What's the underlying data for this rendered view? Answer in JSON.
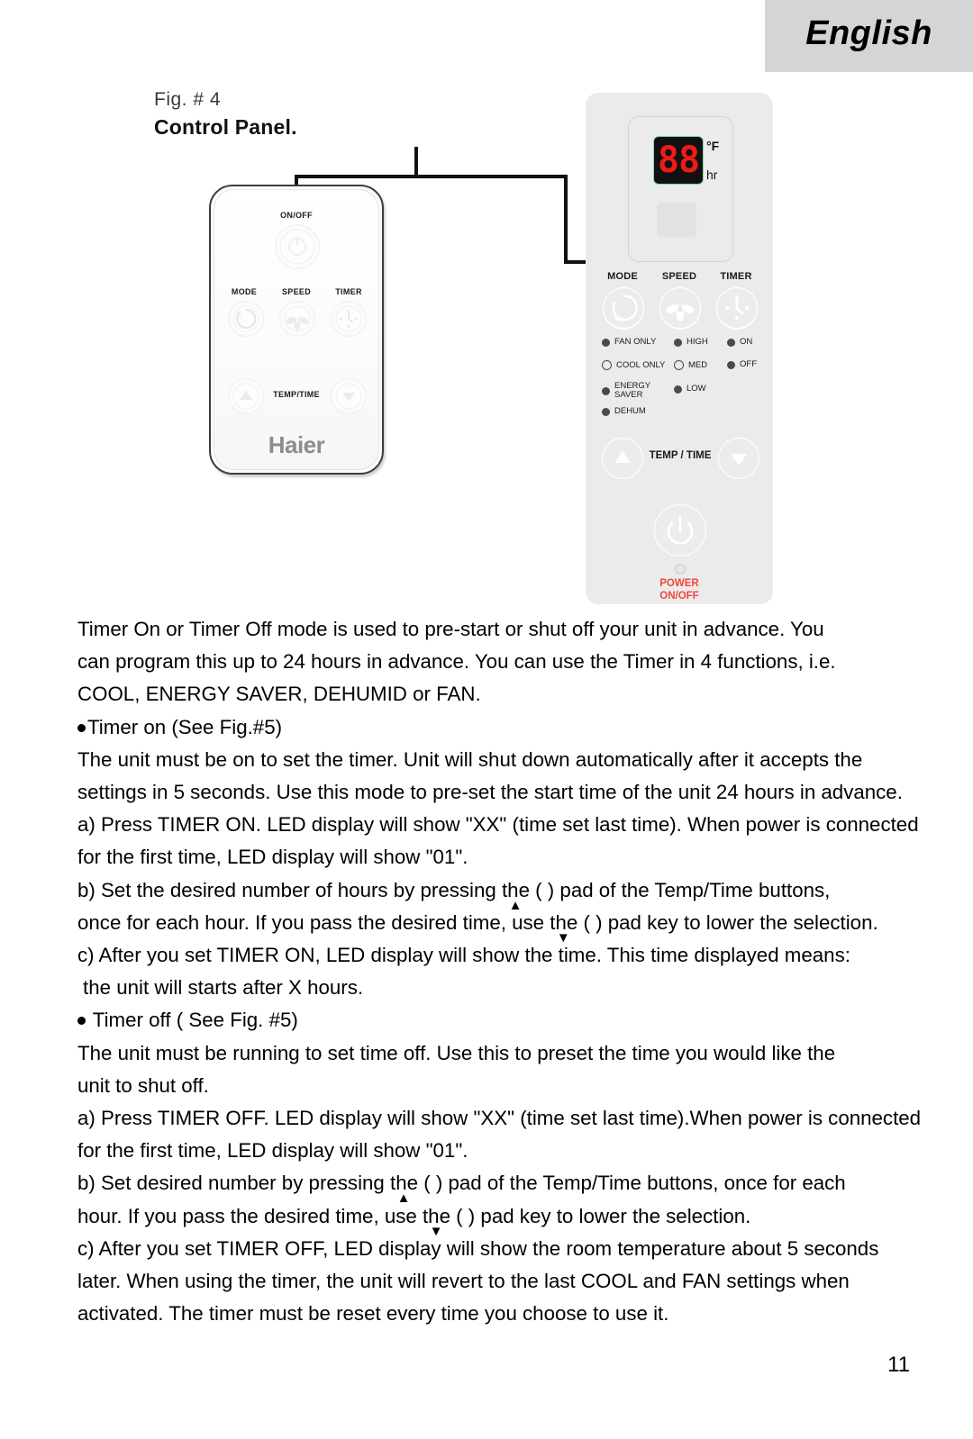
{
  "header": {
    "language_label": "English",
    "band_color": "#d5d5d5"
  },
  "figure": {
    "fig_number": "Fig. # 4",
    "fig_title": "Control Panel.",
    "remote": {
      "brand": "Haier",
      "labels": {
        "on_off": "ON/OFF",
        "mode": "MODE",
        "speed": "SPEED",
        "timer": "TIMER",
        "temp_time": "TEMP/TIME"
      }
    },
    "control_panel": {
      "display": {
        "digits": "88",
        "unit_temp": "°F",
        "unit_hour": "hr",
        "digit_color": "#ee1b17",
        "screen_color": "#111111"
      },
      "buttons": {
        "mode": "MODE",
        "speed": "SPEED",
        "timer": "TIMER",
        "temp_time": "TEMP / TIME",
        "power_line1": "POWER",
        "power_line2": "ON/OFF",
        "power_text_color": "#f0463c"
      },
      "indicators": [
        {
          "label": "FAN ONLY",
          "state": "filled",
          "column": 1,
          "row": 1
        },
        {
          "label": "COOL ONLY",
          "state": "hollow",
          "column": 1,
          "row": 2
        },
        {
          "label": "ENERGY SAVER",
          "state": "filled",
          "column": 1,
          "row": 3
        },
        {
          "label": "DEHUM",
          "state": "filled",
          "column": 1,
          "row": 4
        },
        {
          "label": "HIGH",
          "state": "filled",
          "column": 2,
          "row": 1
        },
        {
          "label": "MED",
          "state": "hollow",
          "column": 2,
          "row": 2
        },
        {
          "label": "LOW",
          "state": "filled",
          "column": 2,
          "row": 3
        },
        {
          "label": "ON",
          "state": "filled",
          "column": 3,
          "row": 1
        },
        {
          "label": "OFF",
          "state": "filled",
          "column": 3,
          "row": 2
        }
      ],
      "indicator_labels": {
        "fan_only": "FAN ONLY",
        "cool_only": "COOL ONLY",
        "energy": "ENERGY",
        "saver": "SAVER",
        "dehum": "DEHUM",
        "high": "HIGH",
        "med": "MED",
        "low": "LOW",
        "on": "ON",
        "off": "OFF"
      }
    }
  },
  "body": {
    "para1_line1": "Timer On or Timer Off mode is used to pre-start or shut off your unit in advance. You",
    "para1_line2": "can program this up to 24 hours in advance. You can use the Timer in 4 functions, i.e.",
    "para1_line3": "COOL, ENERGY SAVER, DEHUMID or FAN.",
    "timer_on_heading": "Timer on (See Fig.#5)",
    "para2_line1": "The unit must be on to set the timer. Unit will shut down automatically after it accepts the",
    "para2_line2": "settings in 5 seconds. Use this mode to pre-set the start time of the unit 24 hours in advance.",
    "on_a_line1": "a) Press TIMER ON. LED display will show \"XX\" (time set last time). When power is connected",
    "on_a_line2": "for the first time, LED display will show \"01\".",
    "on_b_part1": "b) Set the desired number of hours by pressing th",
    "on_b_part2": "e (  ) pad of the Temp/Time buttons,",
    "on_b_line2_part1": "once for each hour. If you pass the desired time, use th",
    "on_b_line2_part2": "e (  ) pad key to lower the selection.",
    "on_c_line1": "c) After you set TIMER ON, LED display will show the time. This time displayed means:",
    "on_c_line2": "the unit will starts after X hours.",
    "timer_off_heading": "Timer off ( See Fig. #5)",
    "para3_line1": "The unit must be running to set time off. Use this to preset the time you would like the",
    "para3_line2": "unit to shut off.",
    "off_a_line1": "a) Press TIMER OFF. LED display will show \"XX\" (time set last time).When power is connected",
    "off_a_line2": "for the first time, LED display will show \"01\".",
    "off_b_part1": "b) Set desired number by pressing th",
    "off_b_part2": "e (  ) pad of the Temp/Time buttons, once for each",
    "off_b_line2_part1": "hour. If you pass the desired time, use th",
    "off_b_line2_part2": "e (  ) pad key to lower the selection.",
    "off_c_line1": "c) After you set TIMER OFF, LED display will show the room temperature about 5 seconds",
    "off_c_line2": "later. When using the timer, the unit will revert to the last COOL and FAN settings when",
    "off_c_line3": "activated. The timer must be reset every time you choose to use it.",
    "arrow_up_glyph": "▲",
    "arrow_down_glyph": "▼"
  },
  "page_number": "11"
}
